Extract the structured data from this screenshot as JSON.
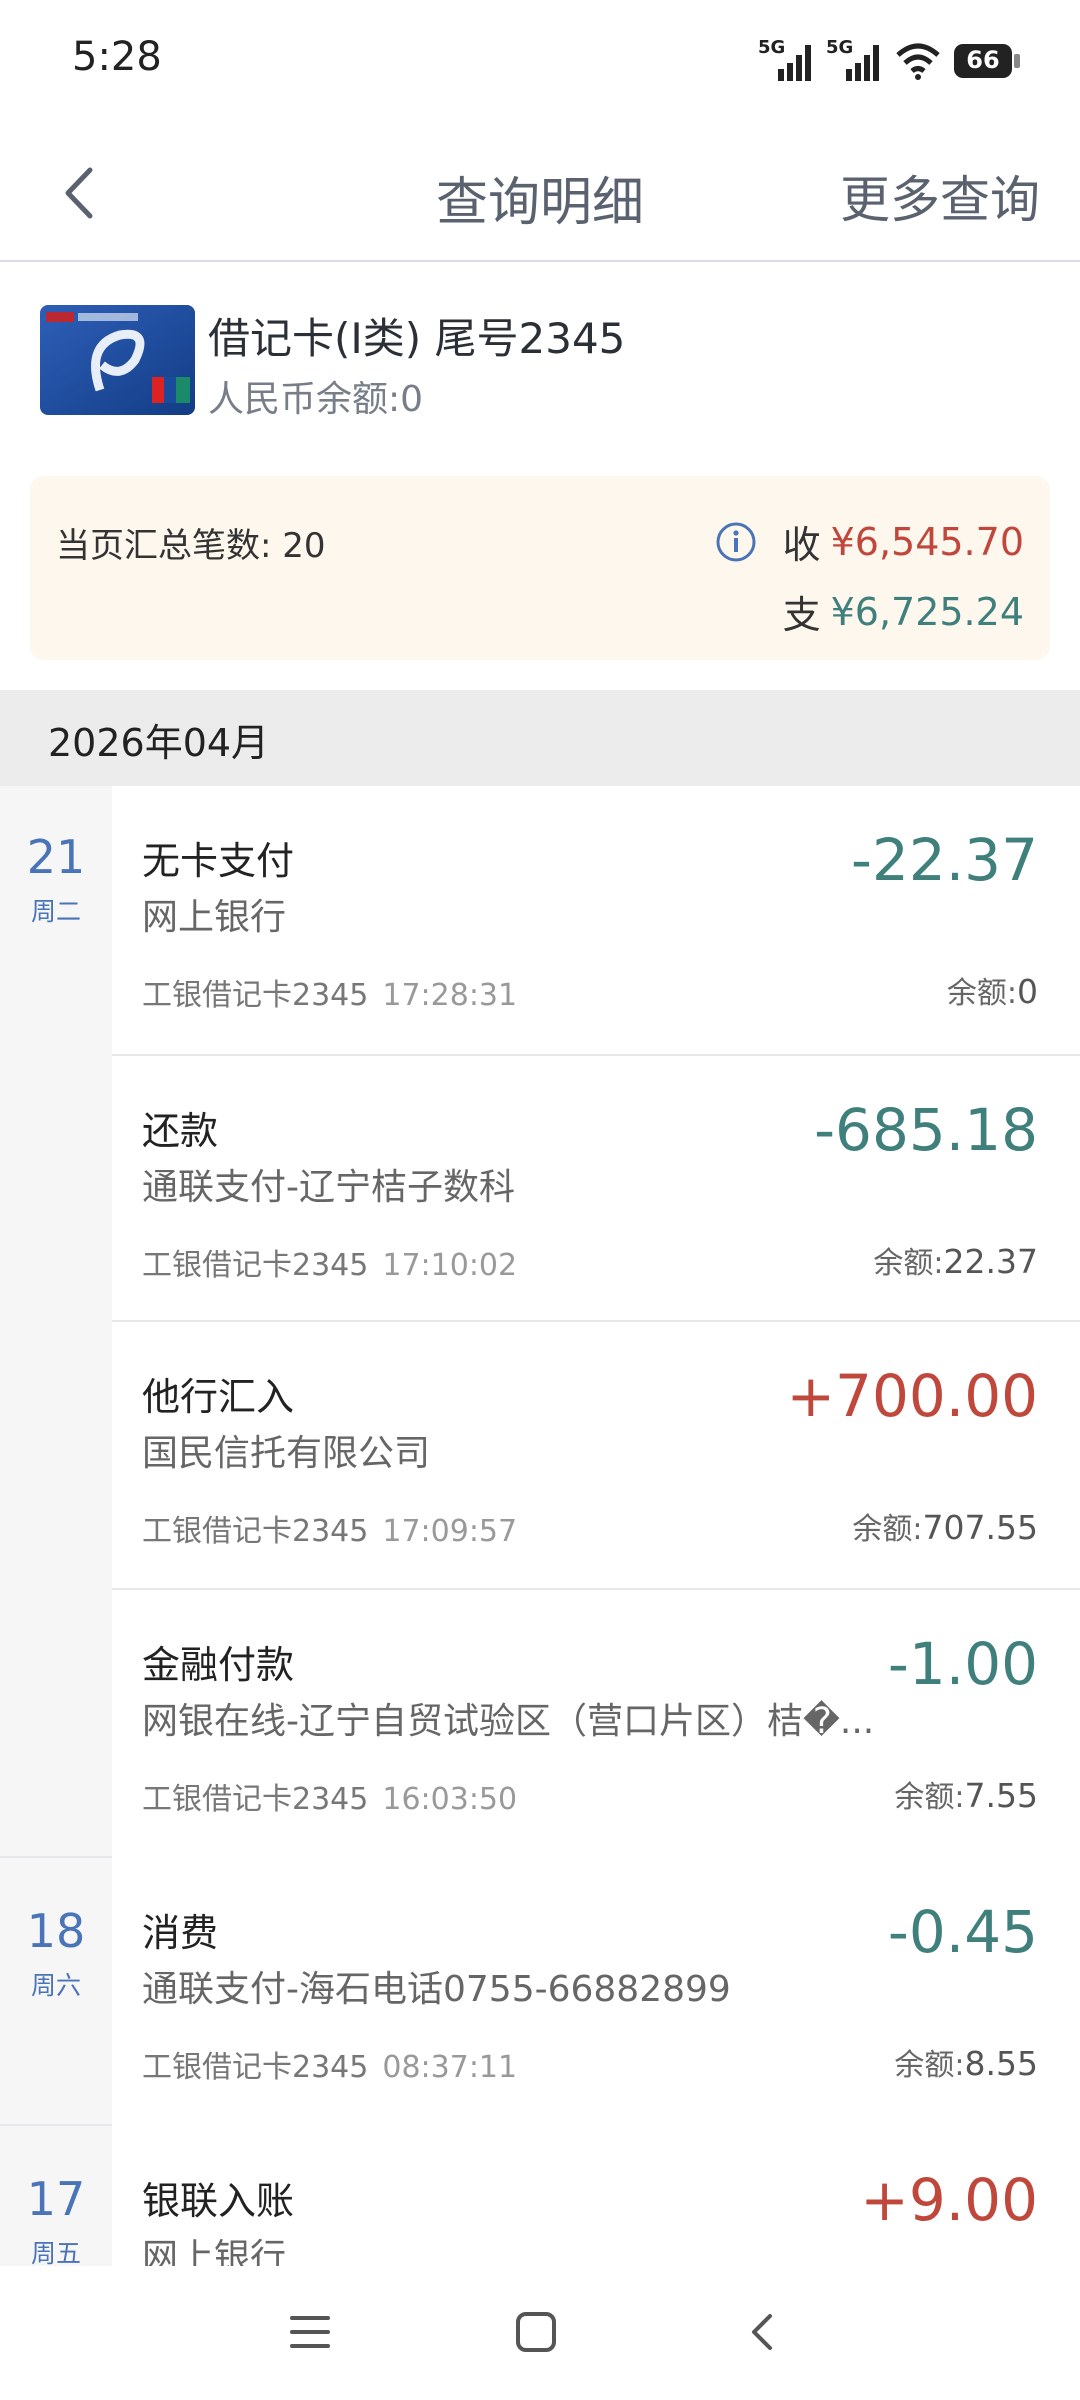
{
  "status_bar": {
    "time": "5:28",
    "signal1": "5G",
    "signal2": "5G",
    "battery": "66"
  },
  "header": {
    "title": "查询明细",
    "more": "更多查询"
  },
  "card": {
    "title": "借记卡(I类) 尾号2345",
    "balance": "人民币余额:0"
  },
  "summary": {
    "count_label": "当页汇总笔数: 20",
    "in_label": "收",
    "in_amount": "¥6,545.70",
    "out_label": "支",
    "out_amount": "¥6,725.24"
  },
  "month": "2026年04月",
  "dates": [
    {
      "day": "21",
      "weekday": "周二"
    },
    {
      "day": "18",
      "weekday": "周六"
    },
    {
      "day": "17",
      "weekday": "周五"
    }
  ],
  "transactions": [
    {
      "title": "无卡支付",
      "sub": "网上银行",
      "card": "工银借记卡2345",
      "time": "17:28:31",
      "amount": "-22.37",
      "balance_label": "余额:",
      "balance": "0",
      "type": "out"
    },
    {
      "title": "还款",
      "sub": "通联支付-辽宁桔子数科",
      "card": "工银借记卡2345",
      "time": "17:10:02",
      "amount": "-685.18",
      "balance_label": "余额:",
      "balance": "22.37",
      "type": "out"
    },
    {
      "title": "他行汇入",
      "sub": "国民信托有限公司",
      "card": "工银借记卡2345",
      "time": "17:09:57",
      "amount": "+700.00",
      "balance_label": "余额:",
      "balance": "707.55",
      "type": "in"
    },
    {
      "title": "金融付款",
      "sub": "网银在线-辽宁自贸试验区（营口片区）桔�...",
      "card": "工银借记卡2345",
      "time": "16:03:50",
      "amount": "-1.00",
      "balance_label": "余额:",
      "balance": "7.55",
      "type": "out"
    },
    {
      "title": "消费",
      "sub": "通联支付-海石电话0755-66882899",
      "card": "工银借记卡2345",
      "time": "08:37:11",
      "amount": "-0.45",
      "balance_label": "余额:",
      "balance": "8.55",
      "type": "out"
    },
    {
      "title": "银联入账",
      "sub": "网上银行",
      "card": "",
      "time": "",
      "amount": "+9.00",
      "balance_label": "",
      "balance": "",
      "type": "in"
    }
  ],
  "colors": {
    "income": "#c0473b",
    "expense": "#3f7f7c",
    "date": "#4a74b8"
  }
}
